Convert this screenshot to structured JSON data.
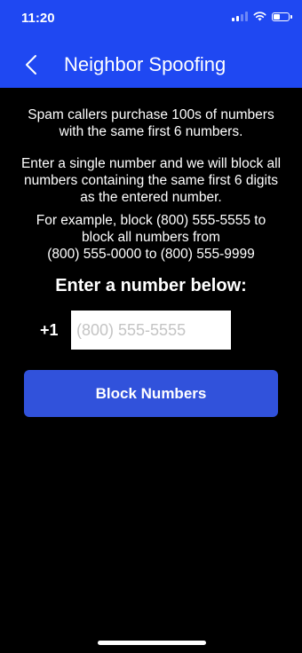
{
  "status_bar": {
    "time": "11:20",
    "icons": [
      "cellular-signal-icon",
      "wifi-icon",
      "battery-icon"
    ]
  },
  "nav": {
    "back_icon": "chevron-left-icon",
    "title": "Neighbor Spoofing"
  },
  "content": {
    "paragraph_1": "Spam callers purchase 100s of numbers with the same first 6 numbers.",
    "paragraph_2": "Enter a single number and we will block all numbers containing the same first 6 digits as the entered number.",
    "paragraph_3_line_1": "For example, block (800) 555-5555 to",
    "paragraph_3_line_2": "block all numbers from",
    "paragraph_3_line_3": "(800) 555-0000 to (800) 555-9999",
    "prompt": "Enter a number below:",
    "country_code": "+1",
    "phone_placeholder": "(800) 555-5555",
    "phone_value": "",
    "block_button_label": "Block Numbers"
  },
  "colors": {
    "header_background": "#1f48f2",
    "button_background": "#3152db",
    "page_background": "#000000"
  }
}
